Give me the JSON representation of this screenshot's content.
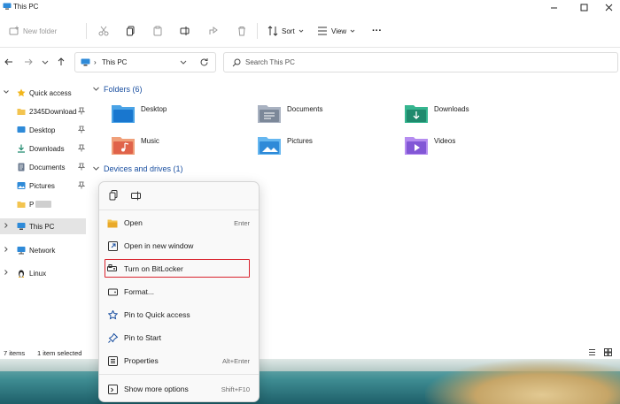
{
  "window": {
    "title": "This PC"
  },
  "toolbar": {
    "new_label": "New folder",
    "sort_label": "Sort",
    "view_label": "View",
    "more_label": "···"
  },
  "address": {
    "path": "This PC",
    "separator": "›"
  },
  "search": {
    "placeholder": "Search This PC"
  },
  "sidebar": {
    "items": [
      {
        "label": "Quick access",
        "icon": "star-icon",
        "pin": false
      },
      {
        "label": "2345Downloads",
        "icon": "folder-icon",
        "pin": true
      },
      {
        "label": "Desktop",
        "icon": "desktop-icon",
        "pin": true
      },
      {
        "label": "Downloads",
        "icon": "download-icon",
        "pin": true
      },
      {
        "label": "Documents",
        "icon": "documents-icon",
        "pin": true
      },
      {
        "label": "Pictures",
        "icon": "pictures-icon",
        "pin": true
      },
      {
        "label": "P",
        "icon": "folder-icon",
        "pin": false
      },
      {
        "label": "This PC",
        "icon": "computer-icon",
        "pin": false
      },
      {
        "label": "Network",
        "icon": "network-icon",
        "pin": false
      },
      {
        "label": "Linux",
        "icon": "linux-icon",
        "pin": false
      }
    ]
  },
  "content": {
    "folders_header": "Folders (6)",
    "drives_header": "Devices and drives (1)",
    "folders": [
      {
        "name": "Desktop",
        "icon": "desktop-folder-icon"
      },
      {
        "name": "Documents",
        "icon": "documents-folder-icon"
      },
      {
        "name": "Downloads",
        "icon": "downloads-folder-icon"
      },
      {
        "name": "Music",
        "icon": "music-folder-icon"
      },
      {
        "name": "Pictures",
        "icon": "pictures-folder-icon"
      },
      {
        "name": "Videos",
        "icon": "videos-folder-icon"
      }
    ]
  },
  "status": {
    "items": "7 items",
    "selected": "1 item selected"
  },
  "context_menu": {
    "items": [
      {
        "label": "Open",
        "shortcut": "Enter",
        "icon": "folder-open-icon"
      },
      {
        "label": "Open in new window",
        "shortcut": "",
        "icon": "new-window-icon"
      },
      {
        "label": "Turn on BitLocker",
        "shortcut": "",
        "icon": "bitlocker-icon"
      },
      {
        "label": "Format...",
        "shortcut": "",
        "icon": "format-icon"
      },
      {
        "label": "Pin to Quick access",
        "shortcut": "",
        "icon": "pin-star-icon"
      },
      {
        "label": "Pin to Start",
        "shortcut": "",
        "icon": "pin-icon"
      },
      {
        "label": "Properties",
        "shortcut": "Alt+Enter",
        "icon": "properties-icon"
      },
      {
        "label": "Show more options",
        "shortcut": "Shift+F10",
        "icon": "more-options-icon"
      }
    ]
  },
  "colors": {
    "accent": "#1a4fa0",
    "highlight_box": "#d9232d",
    "selected_bg": "#e4e4e4"
  }
}
